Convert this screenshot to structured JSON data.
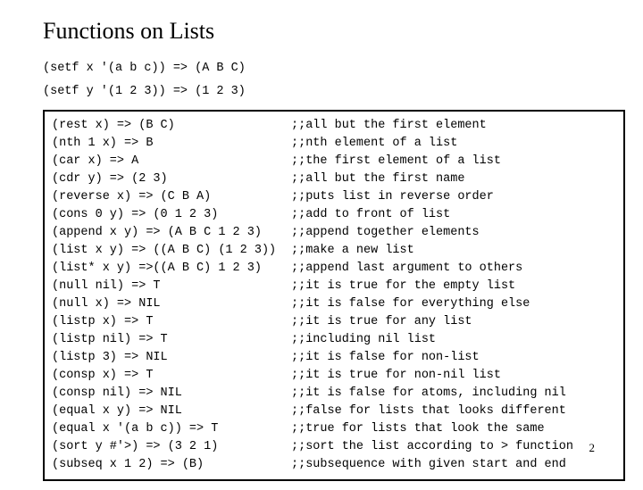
{
  "title": "Functions on Lists",
  "setf": [
    "(setf x '(a b c)) => (A B C)",
    "(setf y '(1 2 3)) => (1 2 3)"
  ],
  "rows": [
    {
      "lhs": "(rest x) => (B C)",
      "rhs": ";;all but the first element"
    },
    {
      "lhs": "(nth 1 x) => B",
      "rhs": ";;nth element of a list"
    },
    {
      "lhs": "(car x) => A",
      "rhs": ";;the first element of a list"
    },
    {
      "lhs": "(cdr y) => (2 3)",
      "rhs": ";;all but the first name"
    },
    {
      "lhs": "(reverse x) => (C B A)",
      "rhs": ";;puts list in reverse order"
    },
    {
      "lhs": "(cons 0 y) => (0 1 2 3)",
      "rhs": ";;add to front of list"
    },
    {
      "lhs": "(append x y) => (A B C 1 2 3)",
      "rhs": ";;append together elements"
    },
    {
      "lhs": "(list x y) => ((A B C) (1 2 3))",
      "rhs": ";;make a new list"
    },
    {
      "lhs": "(list* x y) =>((A B C) 1 2 3)",
      "rhs": ";;append last argument to others"
    },
    {
      "lhs": "(null nil) => T",
      "rhs": ";;it is true for the empty list"
    },
    {
      "lhs": "(null x) => NIL",
      "rhs": ";;it is false for everything else"
    },
    {
      "lhs": "(listp x) => T",
      "rhs": ";;it is true for any list"
    },
    {
      "lhs": "(listp nil) => T",
      "rhs": ";;including nil list"
    },
    {
      "lhs": "(listp 3) => NIL",
      "rhs": ";;it is false for non-list"
    },
    {
      "lhs": "(consp x) => T",
      "rhs": ";;it is true for non-nil list"
    },
    {
      "lhs": "(consp nil) => NIL",
      "rhs": ";;it is false for atoms, including nil"
    },
    {
      "lhs": "(equal x y) => NIL",
      "rhs": ";;false for lists that looks different"
    },
    {
      "lhs": "(equal x '(a b c)) => T",
      "rhs": ";;true for lists that look the same"
    },
    {
      "lhs": "(sort y #'>) => (3 2 1)",
      "rhs": ";;sort the list according to > function"
    },
    {
      "lhs": "(subseq x 1 2) => (B)",
      "rhs": ";;subsequence with given start and end"
    }
  ],
  "pagenum": "2"
}
